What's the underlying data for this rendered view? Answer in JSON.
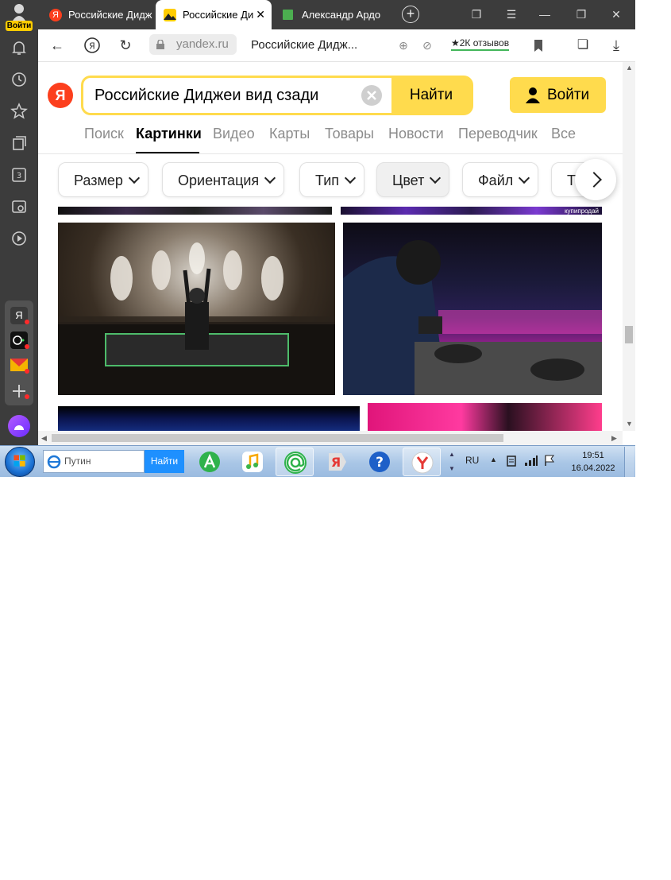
{
  "sidebar": {
    "login_label": "Войти",
    "app_labels": [
      "Я"
    ]
  },
  "tabs": [
    {
      "title": "Российские Дидж",
      "favicon": "yandex-y-icon"
    },
    {
      "title": "Российские Ди",
      "favicon": "image-icon",
      "active": true
    },
    {
      "title": "Александр Ардо",
      "favicon": "green-square-icon"
    }
  ],
  "address": {
    "host": "yandex.ru",
    "title": "Российские Дидж...",
    "reviews": "★2К отзывов"
  },
  "search": {
    "query": "Российские Диджеи вид сзади",
    "find_label": "Найти",
    "login_label": "Войти"
  },
  "services": [
    "Поиск",
    "Картинки",
    "Видео",
    "Карты",
    "Товары",
    "Новости",
    "Переводчик",
    "Все"
  ],
  "active_service": "Картинки",
  "filters": [
    "Размер",
    "Ориентация",
    "Тип",
    "Цвет",
    "Файл",
    "Т"
  ],
  "images": {
    "watermark": "купипродай"
  },
  "taskbar": {
    "search_text": "Путин",
    "search_button": "Найти",
    "lang": "RU",
    "time": "19:51",
    "date": "16.04.2022"
  },
  "colors": {
    "yandex_red": "#fc3f1d",
    "yandex_yellow": "#ffdb4d",
    "browser_dark": "#3c3c3c"
  }
}
